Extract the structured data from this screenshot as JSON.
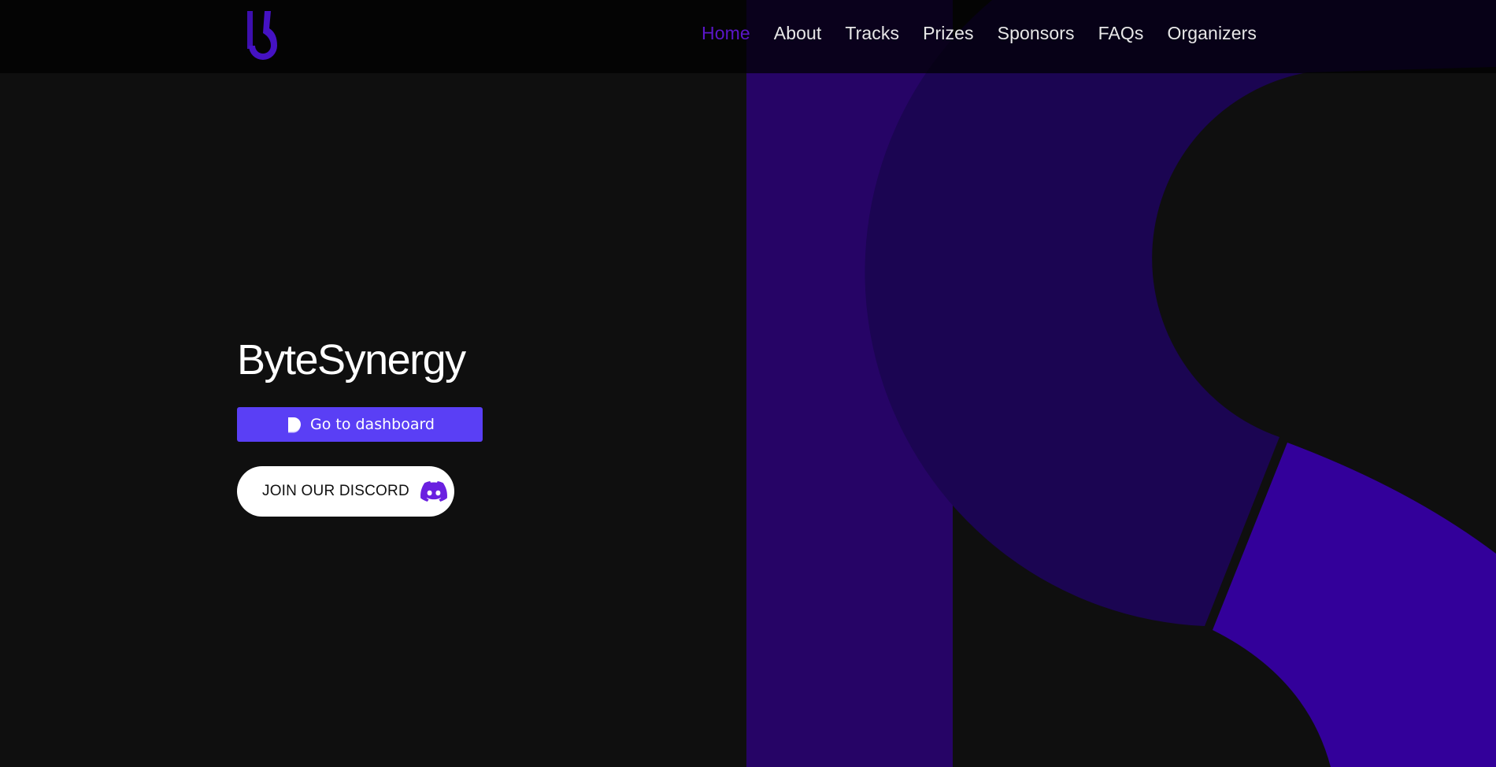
{
  "brand": {
    "logo_icon": "bytesynergy-bs-logo-icon",
    "accent_color": "#5b16c9",
    "button_color": "#5a3ff5"
  },
  "nav": {
    "items": [
      {
        "label": "Home",
        "active": true
      },
      {
        "label": "About",
        "active": false
      },
      {
        "label": "Tracks",
        "active": false
      },
      {
        "label": "Prizes",
        "active": false
      },
      {
        "label": "Sponsors",
        "active": false
      },
      {
        "label": "FAQs",
        "active": false
      },
      {
        "label": "Organizers",
        "active": false
      }
    ]
  },
  "hero": {
    "title": "ByteSynergy",
    "dashboard_button": {
      "label": "Go to dashboard",
      "icon": "devfolio-d-icon"
    },
    "discord_button": {
      "label": "JOIN OUR DISCORD",
      "icon": "discord-icon"
    }
  },
  "background": {
    "art": "large-bs-monogram-graphic",
    "colors": [
      "#260466",
      "#1b0552",
      "#33009a"
    ]
  }
}
